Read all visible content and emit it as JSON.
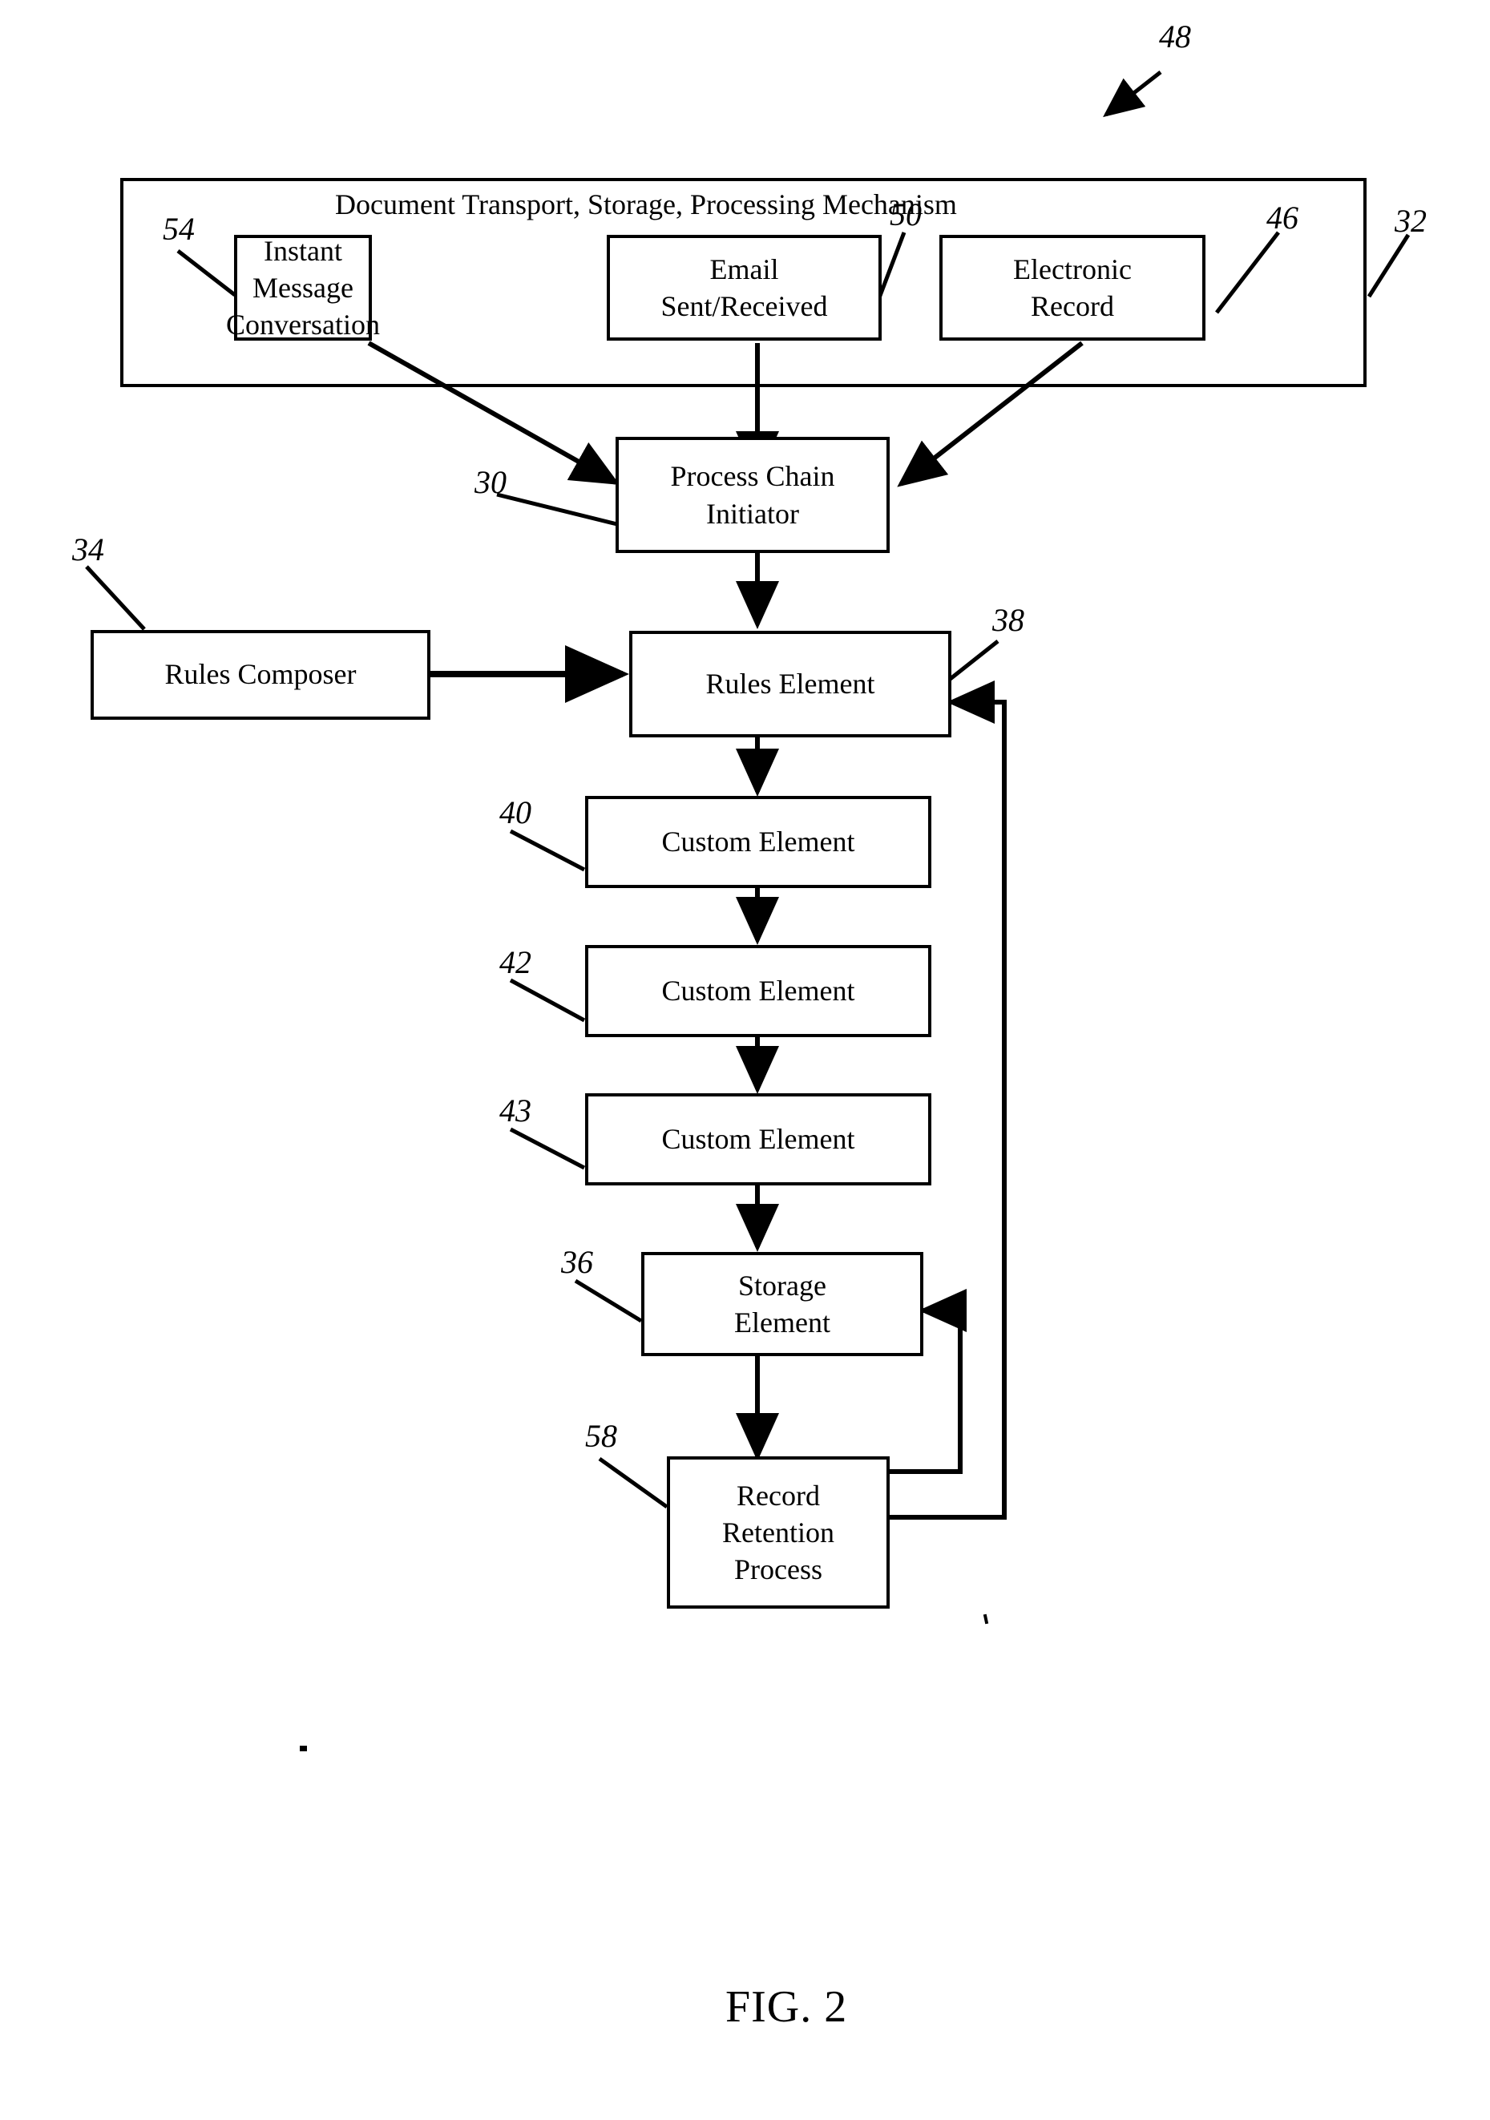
{
  "figure": {
    "label": "FIG. 2",
    "overall_ref": "48"
  },
  "container": {
    "title": "Document Transport, Storage, Processing Mechanism",
    "ref": "32"
  },
  "nodes": [
    {
      "id": "instant-message-conversation",
      "label": "Instant Message\nConversation",
      "ref": "54"
    },
    {
      "id": "email-sent-received",
      "label": "Email\nSent/Received",
      "ref": "50"
    },
    {
      "id": "electronic-record",
      "label": "Electronic\nRecord",
      "ref": "46"
    },
    {
      "id": "process-chain-initiator",
      "label": "Process Chain\nInitiator",
      "ref": "30"
    },
    {
      "id": "rules-composer",
      "label": "Rules Composer",
      "ref": "34"
    },
    {
      "id": "rules-element",
      "label": "Rules Element",
      "ref": "38"
    },
    {
      "id": "custom-element-1",
      "label": "Custom Element",
      "ref": "40"
    },
    {
      "id": "custom-element-2",
      "label": "Custom Element",
      "ref": "42"
    },
    {
      "id": "custom-element-3",
      "label": "Custom Element",
      "ref": "43"
    },
    {
      "id": "storage-element",
      "label": "Storage\nElement",
      "ref": "36"
    },
    {
      "id": "record-retention-process",
      "label": "Record\nRetention\nProcess",
      "ref": "58"
    }
  ],
  "node_text": {
    "instant_message_line1": "Instant Message",
    "instant_message_line2": "Conversation",
    "email_line1": "Email",
    "email_line2": "Sent/Received",
    "electronic_record_line1": "Electronic",
    "electronic_record_line2": "Record",
    "process_chain_line1": "Process Chain",
    "process_chain_line2": "Initiator",
    "rules_composer": "Rules Composer",
    "rules_element": "Rules Element",
    "custom_element_1": "Custom Element",
    "custom_element_2": "Custom Element",
    "custom_element_3": "Custom Element",
    "storage_line1": "Storage",
    "storage_line2": "Element",
    "retention_line1": "Record",
    "retention_line2": "Retention",
    "retention_line3": "Process"
  },
  "refs": {
    "r48": "48",
    "r54": "54",
    "r50": "50",
    "r46": "46",
    "r32": "32",
    "r30": "30",
    "r34": "34",
    "r38": "38",
    "r40": "40",
    "r42": "42",
    "r43": "43",
    "r36": "36",
    "r58": "58"
  },
  "colors": {
    "ink": "#000000",
    "paper": "#ffffff"
  },
  "connections": [
    {
      "from": "instant-message-conversation",
      "to": "process-chain-initiator",
      "style": "diagonal-arrow"
    },
    {
      "from": "email-sent-received",
      "to": "process-chain-initiator",
      "style": "straight-arrow"
    },
    {
      "from": "electronic-record",
      "to": "process-chain-initiator",
      "style": "diagonal-arrow"
    },
    {
      "from": "process-chain-initiator",
      "to": "rules-element",
      "style": "straight-arrow"
    },
    {
      "from": "rules-composer",
      "to": "rules-element",
      "style": "straight-arrow"
    },
    {
      "from": "rules-element",
      "to": "custom-element-1",
      "style": "straight-arrow"
    },
    {
      "from": "custom-element-1",
      "to": "custom-element-2",
      "style": "straight-arrow"
    },
    {
      "from": "custom-element-2",
      "to": "custom-element-3",
      "style": "straight-arrow"
    },
    {
      "from": "custom-element-3",
      "to": "storage-element",
      "style": "straight-arrow"
    },
    {
      "from": "storage-element",
      "to": "record-retention-process",
      "style": "straight-arrow"
    },
    {
      "from": "record-retention-process",
      "to": "storage-element",
      "style": "feedback-loop"
    },
    {
      "from": "record-retention-process",
      "to": "rules-element",
      "style": "feedback-loop"
    }
  ]
}
